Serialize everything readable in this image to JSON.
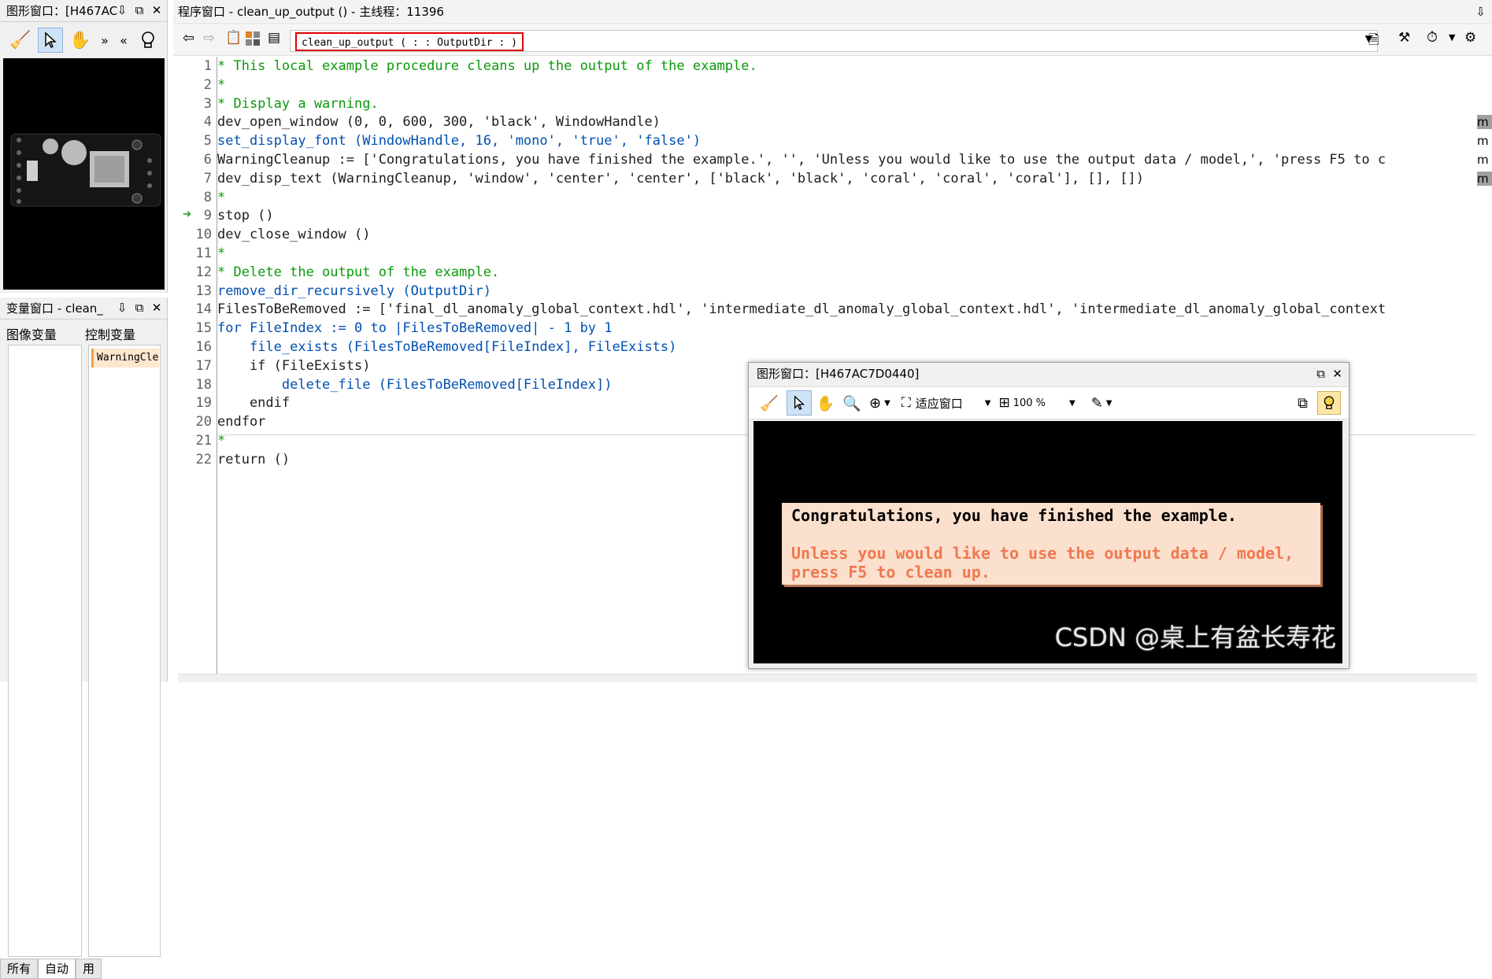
{
  "left_graphics": {
    "title": "图形窗口：[H467AC",
    "header_buttons": [
      "⇩",
      "⧉",
      "✕"
    ]
  },
  "variables": {
    "title": "变量窗口 - clean_",
    "col_image": "图像变量",
    "col_control": "控制变量",
    "control_item": "WarningCle",
    "tabs": [
      "所有",
      "自动",
      "用"
    ]
  },
  "program": {
    "header_title": "程序窗口 - clean_up_output () - 主线程：11396",
    "procedure_signature": "clean_up_output ( : : OutputDir : )",
    "lines": [
      {
        "n": "1",
        "text": "* This local example procedure cleans up the output of the example.",
        "kind": "cm"
      },
      {
        "n": "2",
        "text": "*",
        "kind": "cm"
      },
      {
        "n": "3",
        "text": "* Display a warning.",
        "kind": "cm"
      },
      {
        "n": "4",
        "text": "dev_open_window (0, 0, 600, 300, 'black', WindowHandle)",
        "kind": "as"
      },
      {
        "n": "5",
        "text": "set_display_font (WindowHandle, 16, 'mono', 'true', 'false')",
        "kind": "op"
      },
      {
        "n": "6",
        "text": "WarningCleanup := ['Congratulations, you have finished the example.', '', 'Unless you would like to use the output data / model,', 'press F5 to c",
        "kind": "as"
      },
      {
        "n": "7",
        "text": "dev_disp_text (WarningCleanup, 'window', 'center', 'center', ['black', 'black', 'coral', 'coral', 'coral'], [], [])",
        "kind": "as"
      },
      {
        "n": "8",
        "text": "*",
        "kind": "cm"
      },
      {
        "n": "9",
        "text": "stop ()",
        "kind": "as"
      },
      {
        "n": "10",
        "text": "dev_close_window ()",
        "kind": "as"
      },
      {
        "n": "11",
        "text": "*",
        "kind": "cm"
      },
      {
        "n": "12",
        "text": "* Delete the output of the example.",
        "kind": "cm"
      },
      {
        "n": "13",
        "text": "remove_dir_recursively (OutputDir)",
        "kind": "op"
      },
      {
        "n": "14",
        "text": "FilesToBeRemoved := ['final_dl_anomaly_global_context.hdl', 'intermediate_dl_anomaly_global_context.hdl', 'intermediate_dl_anomaly_global_context",
        "kind": "as"
      },
      {
        "n": "15",
        "text": "for FileIndex := 0 to |FilesToBeRemoved| - 1 by 1",
        "kind": "op"
      },
      {
        "n": "16",
        "text": "    file_exists (FilesToBeRemoved[FileIndex], FileExists)",
        "kind": "op"
      },
      {
        "n": "17",
        "text": "    if (FileExists)",
        "kind": "as"
      },
      {
        "n": "18",
        "text": "        delete_file (FilesToBeRemoved[FileIndex])",
        "kind": "op"
      },
      {
        "n": "19",
        "text": "    endif",
        "kind": "as"
      },
      {
        "n": "20",
        "text": "endfor",
        "kind": "as"
      },
      {
        "n": "21",
        "text": "*",
        "kind": "cm"
      },
      {
        "n": "22",
        "text": "return ()",
        "kind": "as"
      }
    ],
    "right_markers": [
      "m",
      "m",
      "m",
      "m"
    ]
  },
  "float_window": {
    "title": "图形窗口：[H467AC7D0440]",
    "fit_label": "适应窗口",
    "zoom_label": "100 %",
    "messages": [
      {
        "text": "Congratulations, you have finished the example.",
        "color": "#000000"
      },
      {
        "text": "Unless you would like to use the output data / model,",
        "color": "#f07850"
      },
      {
        "text": "press F5 to clean up.",
        "color": "#f07850"
      }
    ]
  },
  "watermark": "CSDN @桌上有盆长寿花",
  "colors": {
    "comment": "#0a9a0a",
    "operator": "#0050b0",
    "highlight_border": "#e00000",
    "coral": "#f07850"
  }
}
